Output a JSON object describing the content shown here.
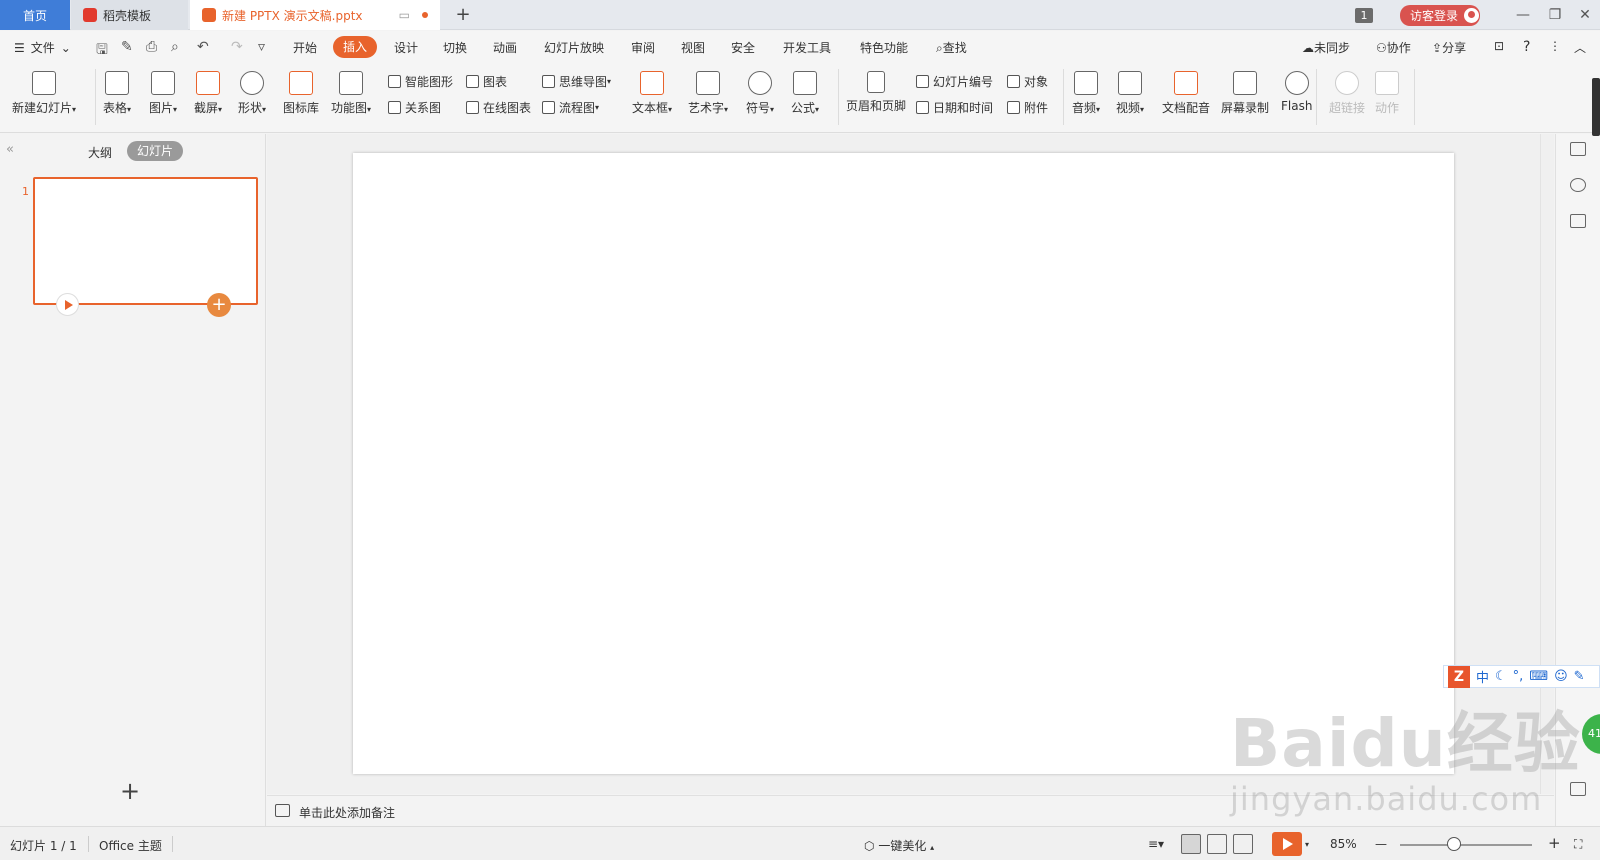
{
  "tabs": {
    "home": "首页",
    "docer": "稻壳模板",
    "document": "新建 PPTX 演示文稿.pptx",
    "new_tab": "+"
  },
  "titlebar": {
    "count": "1",
    "visitor_login": "访客登录",
    "minimize": "—",
    "restore": "❐",
    "close": "✕"
  },
  "menu": {
    "file": "文件",
    "tabs": [
      "开始",
      "插入",
      "设计",
      "切换",
      "动画",
      "幻灯片放映",
      "审阅",
      "视图",
      "安全",
      "开发工具",
      "特色功能"
    ],
    "active_tab": "插入",
    "search": "查找",
    "sync": "未同步",
    "collab": "协作",
    "share": "分享",
    "help": "?"
  },
  "ribbon": {
    "new_slide": "新建幻灯片",
    "table": "表格",
    "picture": "图片",
    "screenshot": "截屏",
    "shape": "形状",
    "icon_library": "图标库",
    "function_chart": "功能图",
    "smart_art": "智能图形",
    "chart": "图表",
    "relation": "关系图",
    "online_chart": "在线图表",
    "mind_map": "思维导图",
    "flow_chart": "流程图",
    "text_box": "文本框",
    "word_art": "艺术字",
    "symbol": "符号",
    "formula": "公式",
    "header_footer": "页眉和页脚",
    "slide_number": "幻灯片编号",
    "object": "对象",
    "date_time": "日期和时间",
    "attachment": "附件",
    "audio": "音频",
    "video": "视频",
    "doc_dubbing": "文档配音",
    "screen_record": "屏幕录制",
    "flash": "Flash",
    "hyperlink": "超链接",
    "action": "动作"
  },
  "left_panel": {
    "outline": "大纲",
    "slides": "幻灯片",
    "slide_number": "1",
    "add": "+"
  },
  "notes": {
    "placeholder": "单击此处添加备注"
  },
  "ime": {
    "logo": "Z",
    "mode": "中",
    "punct": "°,"
  },
  "bubble": "41",
  "watermark": {
    "main": "Baidu经验",
    "sub": "jingyan.baidu.com"
  },
  "status": {
    "slide_info": "幻灯片 1 / 1",
    "theme": "Office 主题",
    "beautify": "一键美化",
    "zoom": "85%",
    "zoom_minus": "—",
    "zoom_plus": "+"
  },
  "colors": {
    "accent": "#e8632c",
    "home_tab": "#3f7dd8",
    "visitor": "#d9534f"
  }
}
